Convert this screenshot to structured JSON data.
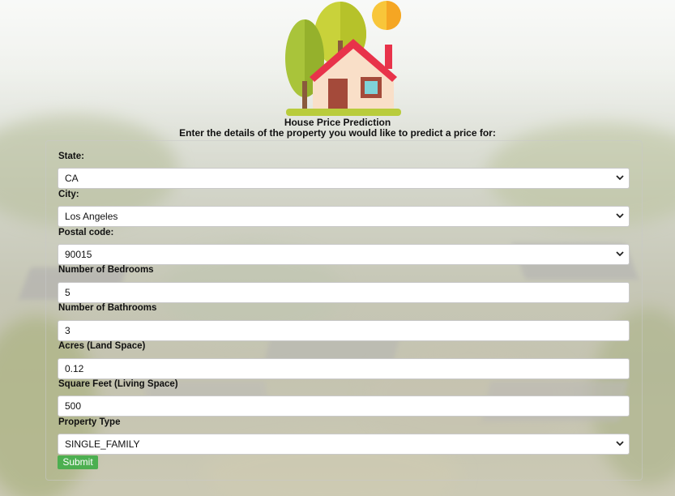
{
  "header": {
    "title": "House Price Prediction",
    "subtitle": "Enter the details of the property you would like to predict a price for:"
  },
  "form": {
    "state": {
      "label": "State:",
      "value": "CA"
    },
    "city": {
      "label": "City:",
      "value": "Los Angeles"
    },
    "postal_code": {
      "label": "Postal code:",
      "value": "90015"
    },
    "bedrooms": {
      "label": "Number of Bedrooms",
      "value": "5"
    },
    "bathrooms": {
      "label": "Number of Bathrooms",
      "value": "3"
    },
    "acres": {
      "label": "Acres (Land Space)",
      "value": "0.12"
    },
    "sqft": {
      "label": "Square Feet (Living Space)",
      "value": "500"
    },
    "property_type": {
      "label": "Property Type",
      "value": "SINGLE_FAMILY"
    },
    "submit_label": "Submit"
  },
  "colors": {
    "submit_button": "#4caf50",
    "logo_roof": "#e8334a",
    "logo_sun": "#f8c63a",
    "logo_tree": "#a9c43a"
  },
  "icons": {
    "logo": "house-logo-icon",
    "dropdown": "chevron-down-icon"
  }
}
